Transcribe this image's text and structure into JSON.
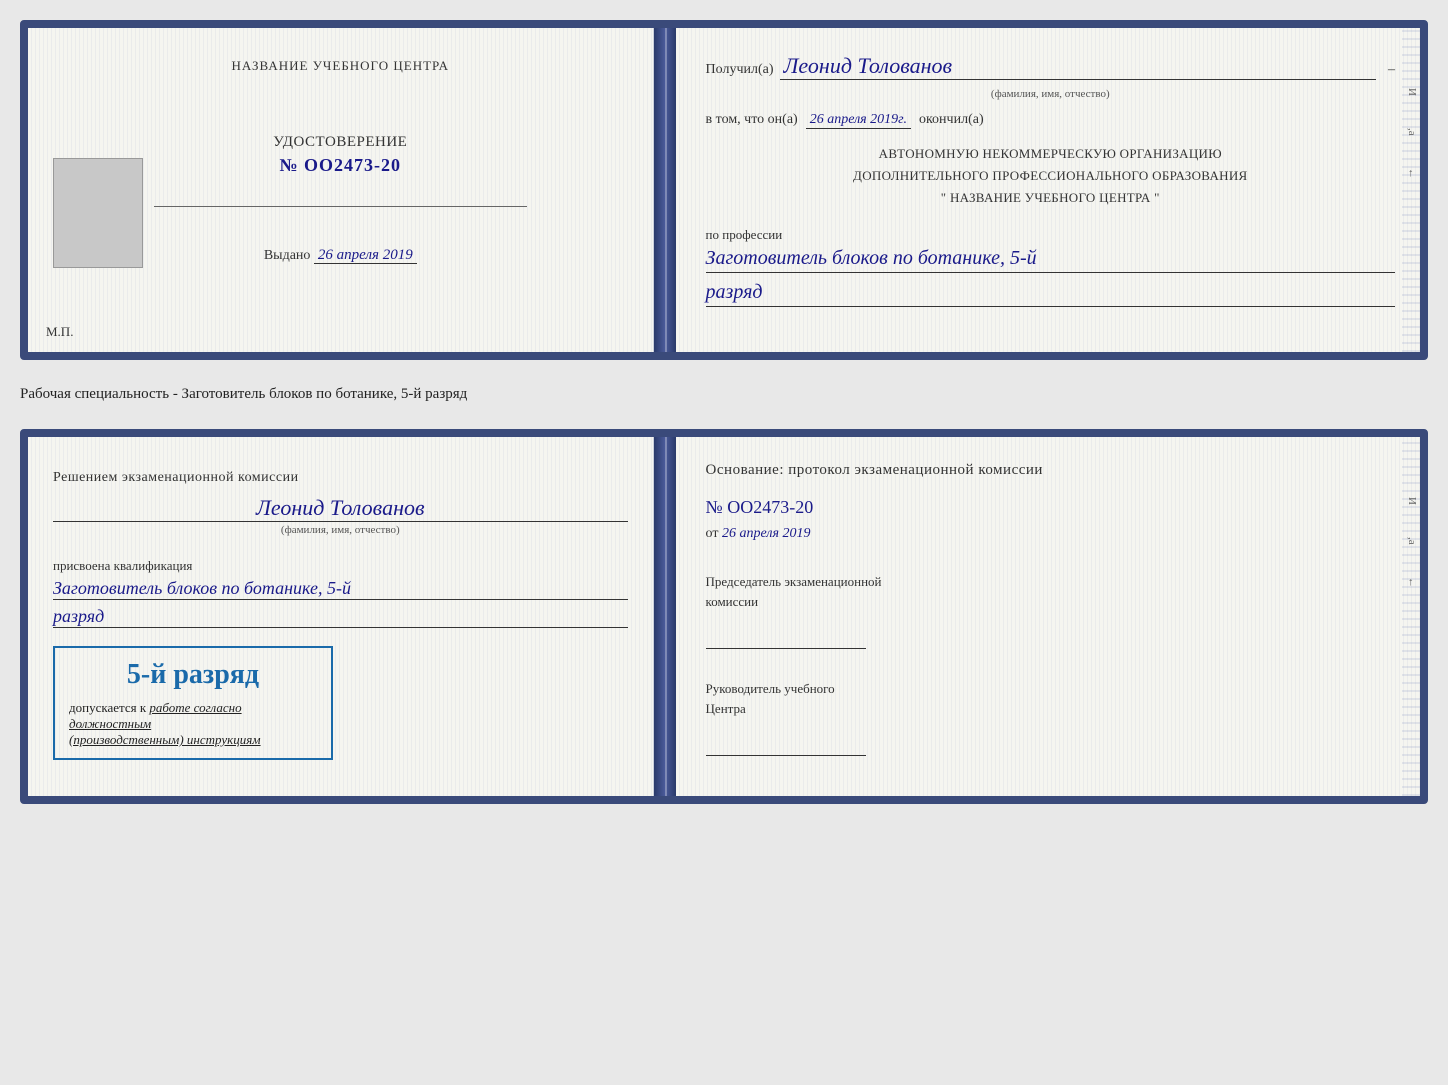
{
  "top_document": {
    "left_page": {
      "title": "НАЗВАНИЕ УЧЕБНОГО ЦЕНТРА",
      "certificate_label": "УДОСТОВЕРЕНИЕ",
      "number": "№ OO2473-20",
      "vydano_label": "Выдано",
      "vydano_date": "26 апреля 2019",
      "mp_label": "М.П."
    },
    "right_page": {
      "recipient_prefix": "Получил(а)",
      "recipient_name": "Леонид Толованов",
      "fio_caption": "(фамилия, имя, отчество)",
      "dash": "–",
      "v_tom_prefix": "в том, что он(а)",
      "v_tom_date": "26 апреля 2019г.",
      "okonchil": "окончил(а)",
      "org_line1": "АВТОНОМНУЮ НЕКОММЕРЧЕСКУЮ ОРГАНИЗАЦИЮ",
      "org_line2": "ДОПОЛНИТЕЛЬНОГО ПРОФЕССИОНАЛЬНОГО ОБРАЗОВАНИЯ",
      "org_name": "\" НАЗВАНИЕ УЧЕБНОГО ЦЕНТРА \"",
      "profession_prefix": "по профессии",
      "profession_value": "Заготовитель блоков по ботанике, 5-й",
      "razryad_value": "разряд"
    }
  },
  "specialty_label": "Рабочая специальность - Заготовитель блоков по ботанике, 5-й разряд",
  "bottom_document": {
    "left_page": {
      "komissia_prefix": "Решением экзаменационной комиссии",
      "komissia_name": "Леонид Толованов",
      "fio_caption": "(фамилия, имя, отчество)",
      "prisvoena_label": "присвоена квалификация",
      "kval_value": "Заготовитель блоков по ботанике, 5-й",
      "razryad_value": "разряд",
      "stamp_main": "5-й разряд",
      "dopuskaetsya_label": "допускается к",
      "dopusk_italic": "работе согласно должностным",
      "dopusk_italic2": "(производственным) инструкциям"
    },
    "right_page": {
      "osnovanie_label": "Основание: протокол экзаменационной комиссии",
      "protocol_number": "№  OO2473-20",
      "ot_prefix": "от",
      "ot_date": "26 апреля 2019",
      "predsedatel_label": "Председатель экзаменационной",
      "komissia_label2": "комиссии",
      "rukovoditel_label": "Руководитель учебного",
      "tsentra_label": "Центра"
    }
  }
}
